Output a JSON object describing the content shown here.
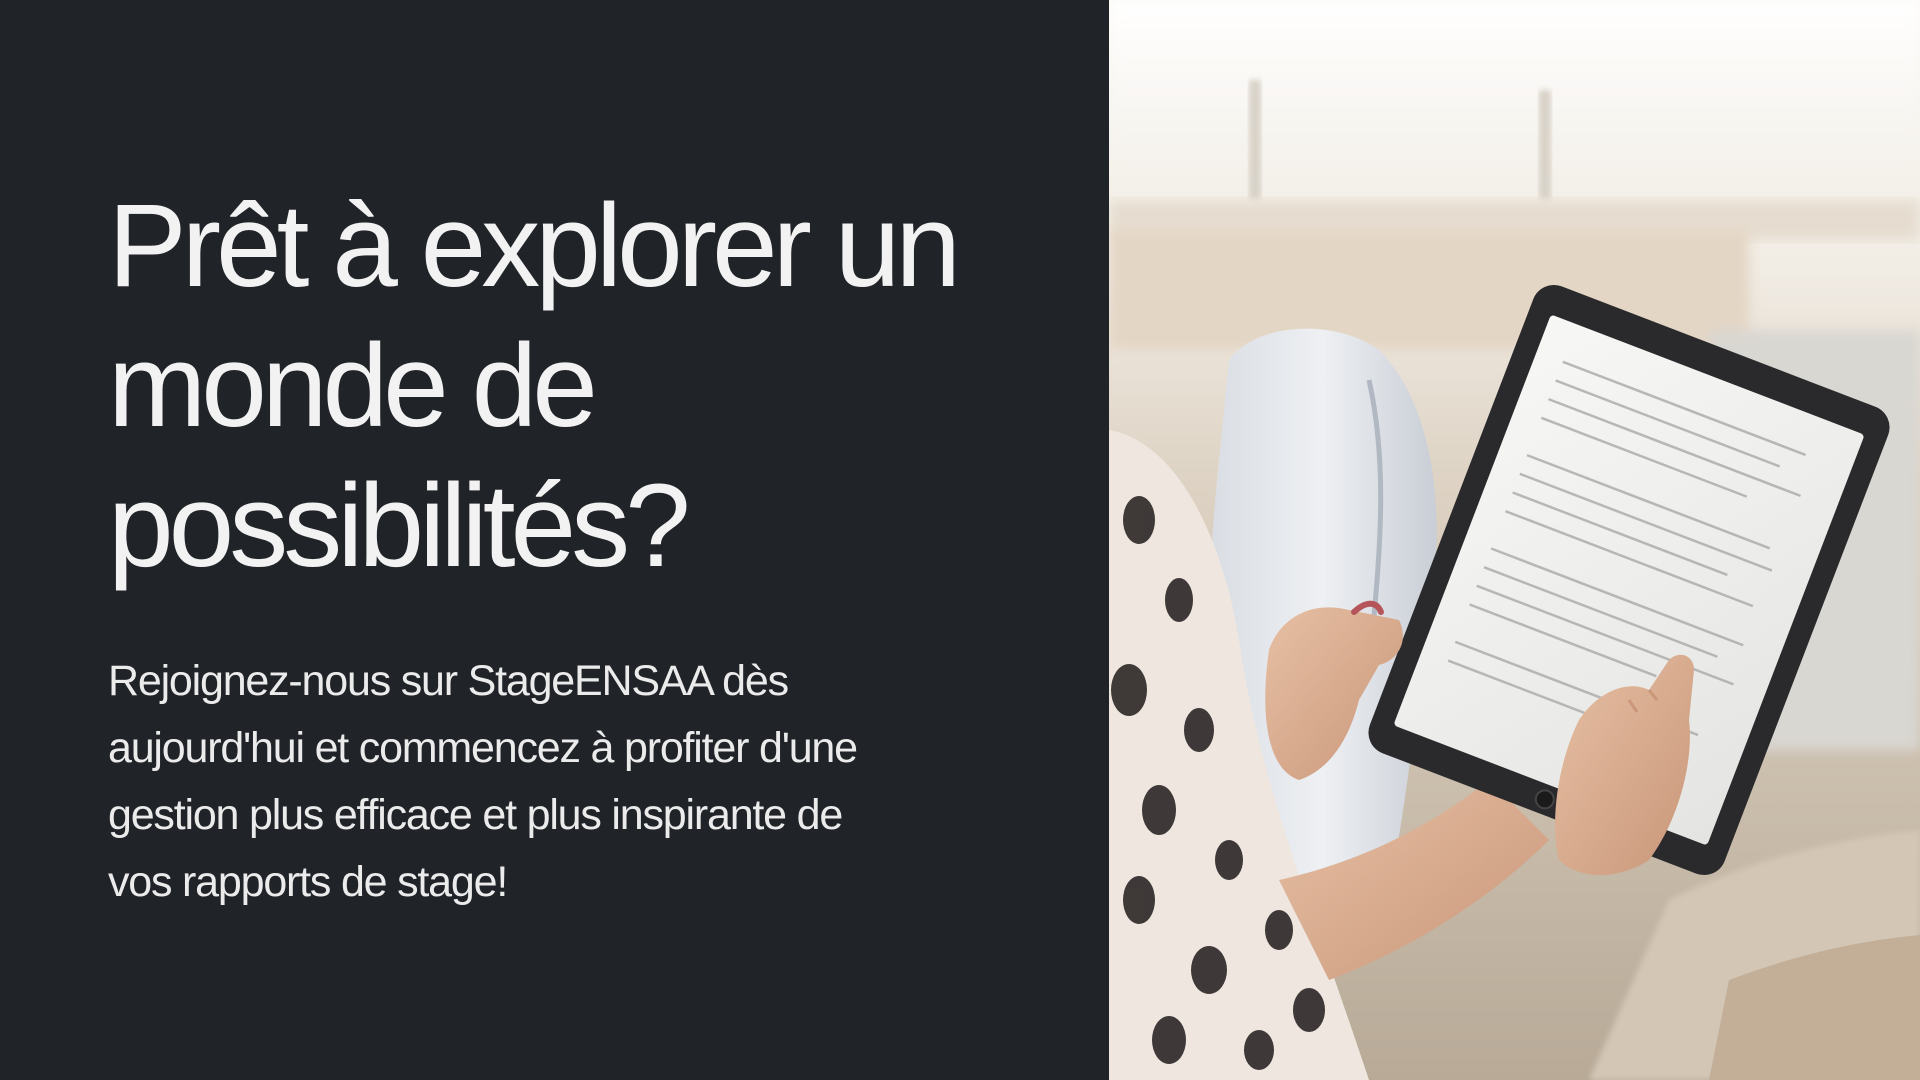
{
  "headline": {
    "lines": [
      "Prêt à explorer un",
      "monde de",
      "possibilités?"
    ]
  },
  "body": {
    "lines": [
      "Rejoignez-nous sur StageENSAA dès",
      "aujourd'hui et commencez à profiter d'une",
      "gestion plus efficace et plus inspirante de",
      "vos rapports de stage!"
    ]
  },
  "colors": {
    "panel_background": "#202328",
    "text": "#f2f2f2"
  },
  "photo": {
    "subject": "person-reading-tablet"
  }
}
